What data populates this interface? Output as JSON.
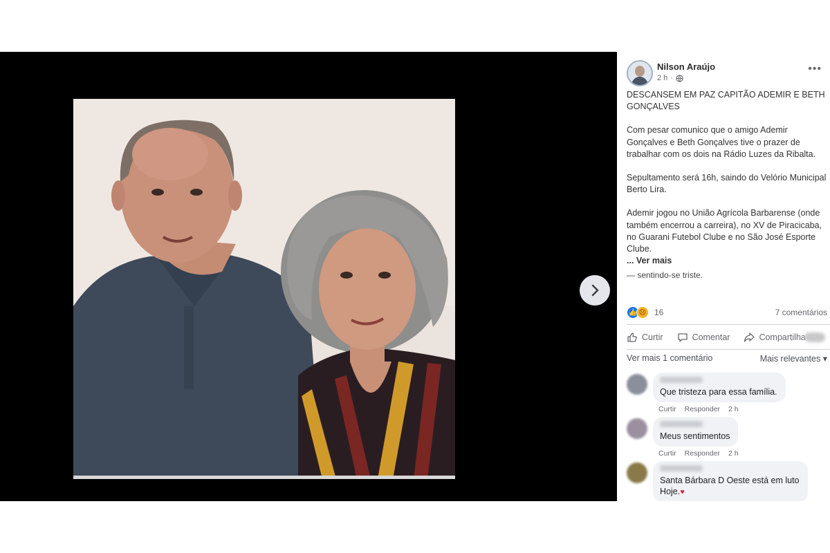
{
  "post": {
    "author": "Nilson Araújo",
    "time": "2 h",
    "headline": "DESCANSEM EM PAZ CAPITÃO ADEMIR E BETH GONÇALVES",
    "paragraph1": "Com pesar comunico que o amigo Ademir Gonçalves e Beth Gonçalves tive o prazer de trabalhar com os dois na Rádio Luzes da Ribalta.",
    "paragraph2": "Sepultamento será 16h, saindo do Velório Municipal Berto Lira.",
    "paragraph3": "Ademir jogou no União Agrícola Barbarense (onde também encerrou a carreira), no XV de Piracicaba, no Guarani Futebol Clube e no São José Esporte Clube.",
    "see_more": "... Ver mais",
    "feeling": "— sentindo-se triste."
  },
  "reactions": {
    "count": "16",
    "comments": "7 comentários"
  },
  "actions": {
    "like": "Curtir",
    "comment": "Comentar",
    "share": "Compartilha"
  },
  "comments_header": {
    "more": "Ver mais 1 comentário",
    "sort": "Mais relevantes"
  },
  "comments": [
    {
      "text": "Que tristeza para essa família.",
      "like": "Curtir",
      "reply": "Responder",
      "time": "2 h"
    },
    {
      "text": "Meus sentimentos",
      "like": "Curtir",
      "reply": "Responder",
      "time": "2 h"
    },
    {
      "text_line1": "Santa Bárbara D Oeste está em luto",
      "text_line2": "Hoje."
    }
  ],
  "colors": {
    "viewer_bg": "#000000",
    "panel_bg": "#ffffff",
    "comment_bubble": "#f0f2f5",
    "like_blue": "#1877f2",
    "heart_red": "#d8243f"
  },
  "icons": [
    "chevron-right-icon",
    "globe-icon",
    "more-dots-icon",
    "like-reaction-icon",
    "sad-reaction-icon",
    "thumbs-up-icon",
    "comment-icon",
    "share-icon",
    "sort-caret-icon",
    "heart-icon"
  ]
}
